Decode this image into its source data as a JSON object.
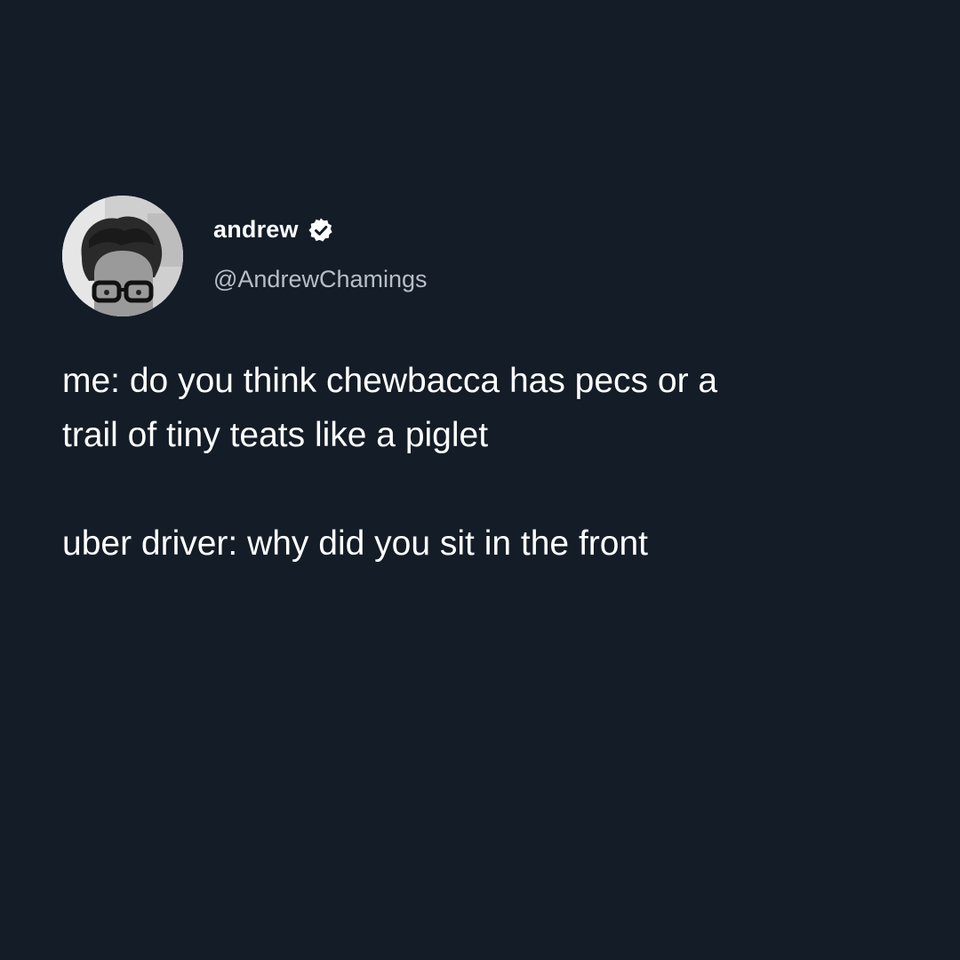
{
  "author": {
    "display_name": "andrew",
    "handle": "@AndrewChamings",
    "verified": true,
    "avatar_icon": "profile-photo"
  },
  "tweet": {
    "line1": "me: do you think chewbacca has pecs or a",
    "line2": "trail of tiny teats like a piglet",
    "line3": "uber driver: why did you sit in the front"
  },
  "colors": {
    "background": "#141c27",
    "text": "#ffffff",
    "handle": "#b8bec6"
  }
}
